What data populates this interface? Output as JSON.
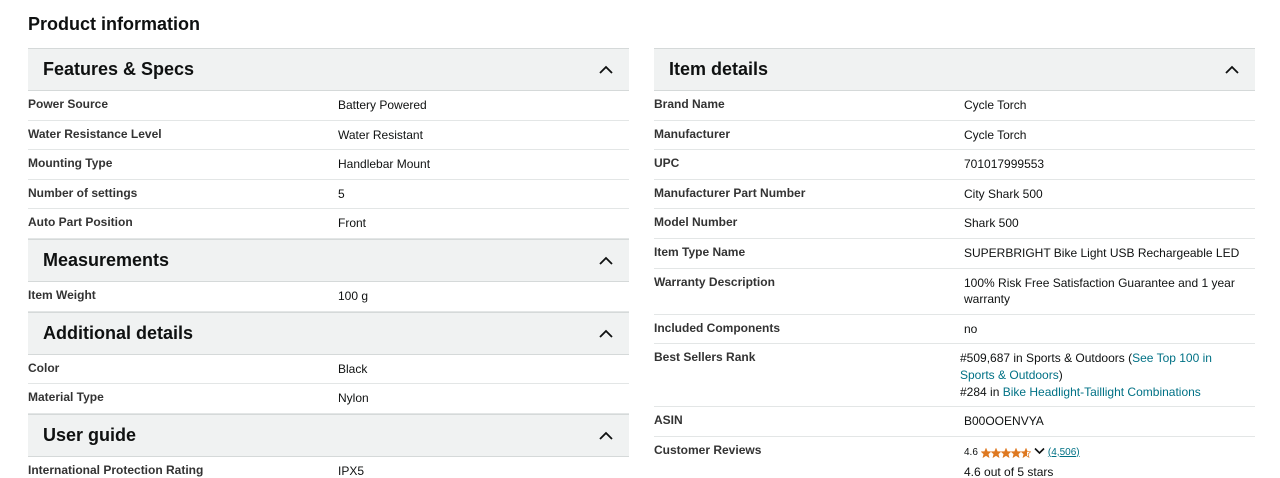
{
  "page_title": "Product information",
  "left_sections": [
    {
      "title": "Features & Specs",
      "rows": [
        {
          "label": "Power Source",
          "value": "Battery Powered"
        },
        {
          "label": "Water Resistance Level",
          "value": "Water Resistant"
        },
        {
          "label": "Mounting Type",
          "value": "Handlebar Mount"
        },
        {
          "label": "Number of settings",
          "value": "5"
        },
        {
          "label": "Auto Part Position",
          "value": "Front"
        }
      ]
    },
    {
      "title": "Measurements",
      "rows": [
        {
          "label": "Item Weight",
          "value": "100 g"
        }
      ]
    },
    {
      "title": "Additional details",
      "rows": [
        {
          "label": "Color",
          "value": "Black"
        },
        {
          "label": "Material Type",
          "value": "Nylon"
        }
      ]
    },
    {
      "title": "User guide",
      "rows": [
        {
          "label": "International Protection Rating",
          "value": "IPX5"
        }
      ]
    }
  ],
  "right_section": {
    "title": "Item details",
    "rows": [
      {
        "label": "Brand Name",
        "value": "Cycle Torch"
      },
      {
        "label": "Manufacturer",
        "value": "Cycle Torch"
      },
      {
        "label": "UPC",
        "value": "701017999553"
      },
      {
        "label": "Manufacturer Part Number",
        "value": "City Shark 500"
      },
      {
        "label": "Model Number",
        "value": "Shark 500"
      },
      {
        "label": "Item Type Name",
        "value": "SUPERBRIGHT Bike Light USB Rechargeable LED"
      },
      {
        "label": "Warranty Description",
        "value": "100% Risk Free Satisfaction Guarantee and 1 year warranty"
      },
      {
        "label": "Included Components",
        "value": "no"
      }
    ],
    "best_sellers": {
      "label": "Best Sellers Rank",
      "rank1_text": "#509,687 in Sports & Outdoors (",
      "rank1_link": "See Top 100 in Sports & Outdoors",
      "rank1_close": ")",
      "rank2_prefix": "#284 in ",
      "rank2_link": "Bike Headlight-Taillight Combinations"
    },
    "asin": {
      "label": "ASIN",
      "value": "B00OOENVYA"
    },
    "reviews": {
      "label": "Customer Reviews",
      "rating": "4.6",
      "rating_value": 4.6,
      "count": "(4,506)",
      "summary": "4.6 out of 5 stars"
    }
  },
  "colors": {
    "header_bg": "#f0f2f2",
    "link": "#007185",
    "star": "#de7921"
  }
}
